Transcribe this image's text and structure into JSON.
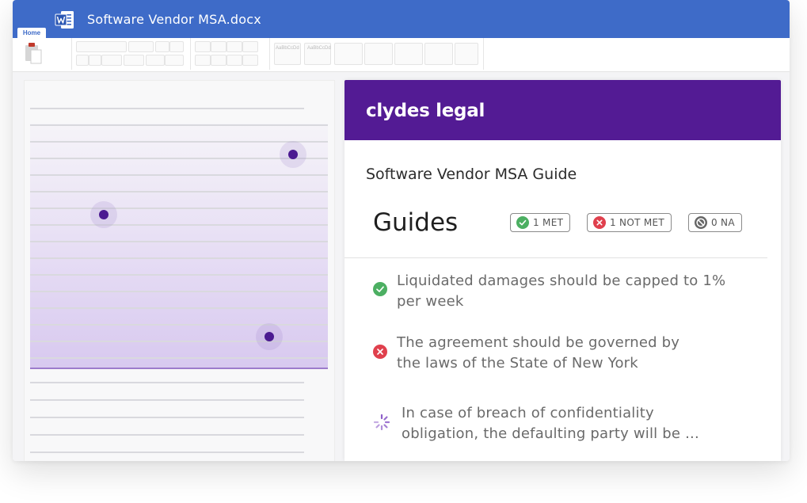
{
  "window": {
    "title": "Software Vendor MSA.docx",
    "active_tab": "Home",
    "accent_color": "#3e6bc8"
  },
  "ribbon": {
    "labels": [
      "AaBbCcDd",
      "AaBbCcDd"
    ]
  },
  "panel": {
    "brand": "clydes legal",
    "brand_color": "#531b94",
    "document_guide_title": "Software Vendor MSA Guide",
    "guides_heading": "Guides",
    "badges": [
      {
        "label": "1 MET",
        "status": "met",
        "icon": "check-circle-icon",
        "color": "#4caf62"
      },
      {
        "label": "1 NOT MET",
        "status": "not-met",
        "icon": "x-circle-icon",
        "color": "#e0404d"
      },
      {
        "label": "0 NA",
        "status": "na",
        "icon": "ban-icon",
        "color": "#666666"
      }
    ],
    "guides": [
      {
        "status": "met",
        "icon": "check-circle-icon",
        "text_line1": "Liquidated damages should be capped to 1%",
        "text_line2": "per week"
      },
      {
        "status": "not-met",
        "icon": "x-circle-icon",
        "text_line1": "The agreement should be governed by",
        "text_line2": "the laws of the State of New York"
      },
      {
        "status": "loading",
        "icon": "spinner-icon",
        "text_line1": "In case of breach of confidentiality",
        "text_line2": "obligation, the defaulting party will be ..."
      }
    ]
  }
}
